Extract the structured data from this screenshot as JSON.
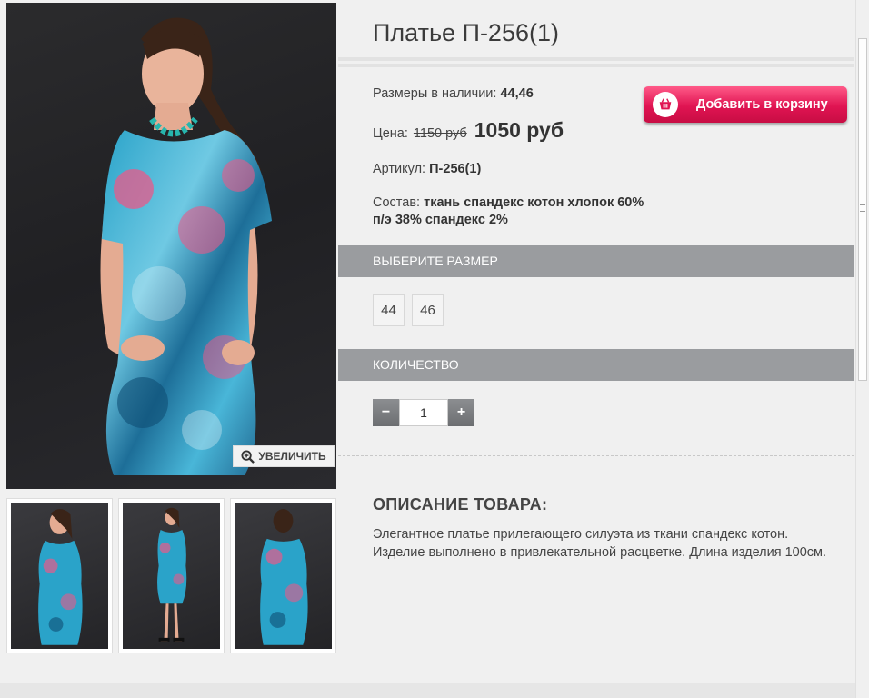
{
  "product": {
    "title": "Платье П-256(1)",
    "sizes_label": "Размеры в наличии:",
    "sizes_value": "44,46",
    "price_label": "Цена:",
    "old_price": "1150 руб",
    "new_price": "1050 руб",
    "sku_label": "Артикул:",
    "sku_value": "П-256(1)",
    "composition_label": "Состав:",
    "composition_value": "ткань спандекс котон хлопок 60% п/э 38% спандекс 2%"
  },
  "cart": {
    "add_label": "Добавить в корзину",
    "icon": "basket-icon"
  },
  "zoom": {
    "label": "УВЕЛИЧИТЬ",
    "icon": "magnifier-plus-icon"
  },
  "size_section": {
    "header": "ВЫБЕРИТЕ РАЗМЕР",
    "options": [
      "44",
      "46"
    ]
  },
  "quantity_section": {
    "header": "КОЛИЧЕСТВО",
    "minus": "−",
    "plus": "+",
    "value": "1"
  },
  "description": {
    "title": "ОПИСАНИЕ ТОВАРА:",
    "text": "Элегантное платье прилегающего силуэта из ткани спандекс котон. Изделие выполнено в привлекательной расцветке. Длина изделия 100см."
  },
  "colors": {
    "accent": "#e01452",
    "section_bar": "#9a9c9f",
    "photo_bg": "#232326",
    "dress_blue": "#2aa3c9",
    "dress_pink": "#e85a8a"
  }
}
